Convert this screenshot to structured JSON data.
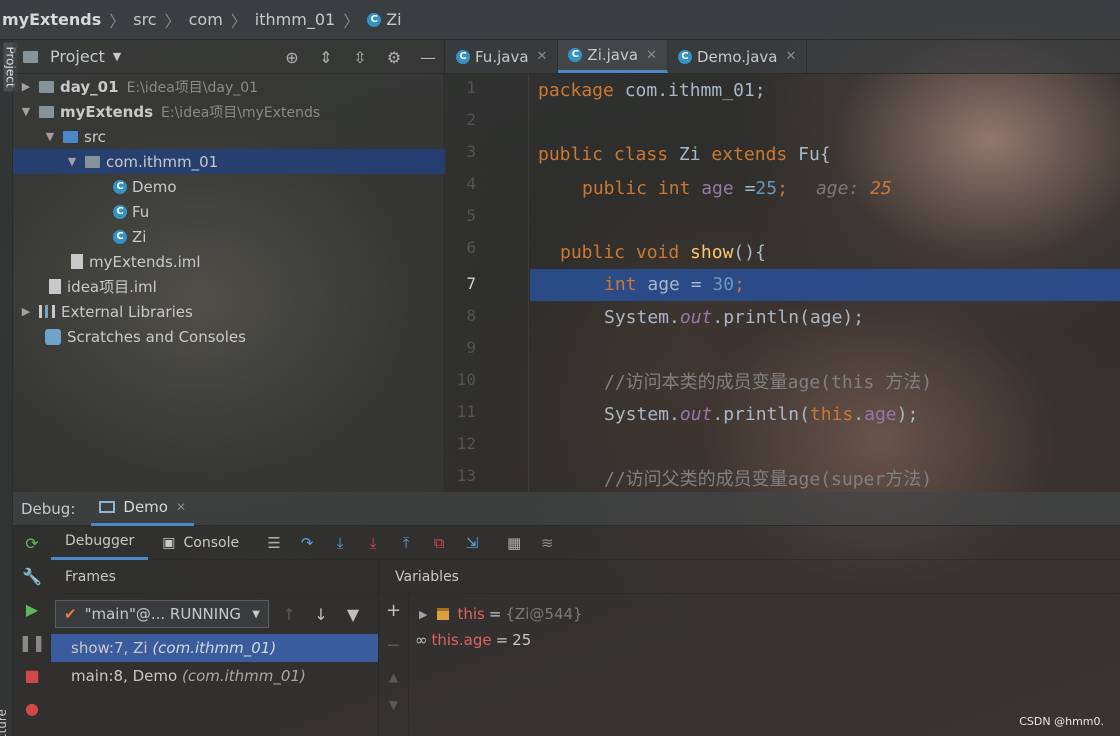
{
  "breadcrumb": {
    "project": "myExtends",
    "src": "src",
    "com": "com",
    "pkg": "ithmm_01",
    "cls": "Zi"
  },
  "side_tabs": {
    "project": "Project",
    "structure": "Structure"
  },
  "project_panel": {
    "title": "Project",
    "tree": [
      {
        "name": "day_01",
        "path": "E:\\idea项目\\day_01"
      },
      {
        "name": "myExtends",
        "path": "E:\\idea项目\\myExtends"
      },
      {
        "name": "src"
      },
      {
        "name": "com.ithmm_01"
      },
      {
        "name": "Demo"
      },
      {
        "name": "Fu"
      },
      {
        "name": "Zi"
      },
      {
        "name": "myExtends.iml"
      },
      {
        "name": "idea项目.iml"
      },
      {
        "name": "External Libraries"
      },
      {
        "name": "Scratches and Consoles"
      }
    ]
  },
  "editor": {
    "tabs": [
      "Fu.java",
      "Zi.java",
      "Demo.java"
    ],
    "active_tab": "Zi.java",
    "line_numbers": [
      "1",
      "2",
      "3",
      "4",
      "5",
      "6",
      "7",
      "8",
      "9",
      "10",
      "11",
      "12",
      "13"
    ],
    "current_line": "7",
    "code": {
      "l1_kw": "package",
      "l1_rest": " com.ithmm_01;",
      "l3_kw": "public class",
      "l3_name": " Zi ",
      "l3_ext": "extends",
      "l3_rest": " Fu{",
      "l4_kw": "public int",
      "l4_field": " age ",
      "l4_eq": "=",
      "l4_num": "25",
      "l4_semi": ";",
      "l4_hint": "age: ",
      "l4_hintv": "25",
      "l6_kw": "public void",
      "l6_fn": " show",
      "l6_rest": "(){",
      "l7_kw": "int",
      "l7_rest": " age = ",
      "l7_num": "30",
      "l7_semi": ";",
      "l8_a": "System.",
      "l8_out": "out",
      "l8_b": ".println(age);",
      "l10_cm": "//访问本类的成员变量age(this 方法)",
      "l11_a": "System.",
      "l11_out": "out",
      "l11_b": ".println(",
      "l11_this": "this",
      "l11_dot": ".",
      "l11_age": "age",
      "l11_end": ");",
      "l13_cm": "//访问父类的成员变量age(super方法)"
    }
  },
  "debug": {
    "label": "Debug:",
    "session": "Demo",
    "tabs": {
      "debugger": "Debugger",
      "console": "Console"
    },
    "frames_title": "Frames",
    "thread": "\"main\"@... RUNNING",
    "frames": [
      {
        "method": "show:7, Zi",
        "pkg": "(com.ithmm_01)"
      },
      {
        "method": "main:8, Demo",
        "pkg": "(com.ithmm_01)"
      }
    ],
    "variables_title": "Variables",
    "variables": [
      {
        "name": "this",
        "value": "{Zi@544}"
      },
      {
        "name": "this.age",
        "value": "25"
      }
    ]
  },
  "watermark": "CSDN @hmm0."
}
